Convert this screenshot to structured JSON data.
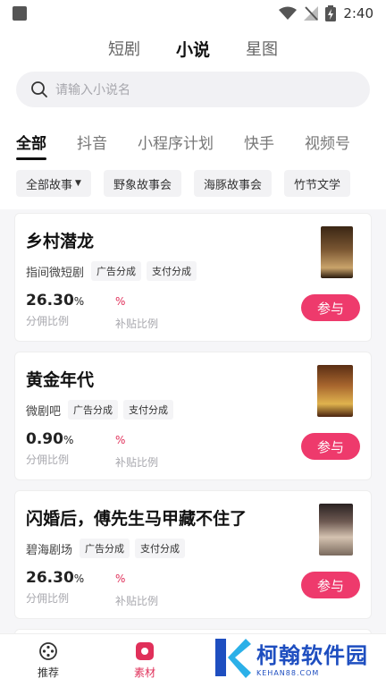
{
  "status_bar": {
    "time": "2:40"
  },
  "top_tabs": [
    {
      "label": "短剧",
      "active": false
    },
    {
      "label": "小说",
      "active": true
    },
    {
      "label": "星图",
      "active": false
    }
  ],
  "search": {
    "placeholder": "请输入小说名"
  },
  "category_tabs": [
    {
      "label": "全部",
      "active": true
    },
    {
      "label": "抖音"
    },
    {
      "label": "小程序计划"
    },
    {
      "label": "快手"
    },
    {
      "label": "视频号"
    }
  ],
  "filters": [
    {
      "label": "全部故事",
      "has_caret": true
    },
    {
      "label": "野象故事会"
    },
    {
      "label": "海豚故事会"
    },
    {
      "label": "竹节文学"
    }
  ],
  "cards": [
    {
      "title": "乡村潜龙",
      "source": "指间微短剧",
      "tags": [
        "广告分成",
        "支付分成"
      ],
      "commission_value": "26.30",
      "commission_unit": "%",
      "commission_label": "分佣比例",
      "subsidy_value": "%",
      "subsidy_label": "补贴比例",
      "button": "参与",
      "cover_colors": [
        "#5a3b22",
        "#c9a36a"
      ]
    },
    {
      "title": "黄金年代",
      "source": "微剧吧",
      "tags": [
        "广告分成",
        "支付分成"
      ],
      "commission_value": "0.90",
      "commission_unit": "%",
      "commission_label": "分佣比例",
      "subsidy_value": "%",
      "subsidy_label": "补贴比例",
      "button": "参与",
      "cover_colors": [
        "#6b3a1e",
        "#d9a441"
      ]
    },
    {
      "title": "闪婚后，傅先生马甲藏不住了",
      "source": "碧海剧场",
      "tags": [
        "广告分成",
        "支付分成"
      ],
      "commission_value": "26.30",
      "commission_unit": "%",
      "commission_label": "分佣比例",
      "subsidy_value": "%",
      "subsidy_label": "补贴比例",
      "button": "参与",
      "cover_colors": [
        "#3a2a2a",
        "#c8b4a0"
      ]
    }
  ],
  "bottom_nav": [
    {
      "label": "推荐",
      "icon": "film-reel-icon",
      "active": false
    },
    {
      "label": "素材",
      "icon": "material-icon",
      "active": true
    }
  ],
  "watermark": {
    "title": "柯翰软件园",
    "sub": "KEHAN88.COM"
  },
  "colors": {
    "accent": "#ee3a6c",
    "brand_blue": "#1e4ec0"
  }
}
